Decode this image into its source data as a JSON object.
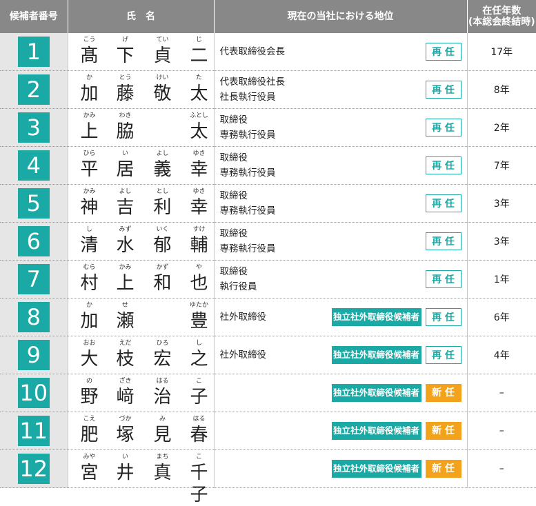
{
  "header": {
    "col_number": "候補者番号",
    "col_name": "氏　名",
    "col_position": "現在の当社における地位",
    "col_years_line1": "在任年数",
    "col_years_line2": "(本総会終結時)"
  },
  "badges": {
    "reappoint": "再 任",
    "new": "新 任",
    "independent": "独立社外取締役候補者"
  },
  "colors": {
    "teal": "#1aa9a5",
    "orange": "#f3a31b",
    "header_gray": "#888888"
  },
  "rows": [
    {
      "number": "1",
      "name": [
        {
          "k": "髙",
          "r": "こう"
        },
        {
          "k": "下",
          "r": "げ"
        },
        {
          "k": "貞",
          "r": "てい"
        },
        {
          "k": "二",
          "r": "じ"
        }
      ],
      "position": [
        "代表取締役会長"
      ],
      "independent": false,
      "status": "reappoint",
      "years": "17年"
    },
    {
      "number": "2",
      "name": [
        {
          "k": "加",
          "r": "か"
        },
        {
          "k": "藤",
          "r": "とう"
        },
        {
          "k": "敬",
          "r": "けい"
        },
        {
          "k": "太",
          "r": "た"
        }
      ],
      "position": [
        "代表取締役社長",
        "社長執行役員"
      ],
      "independent": false,
      "status": "reappoint",
      "years": "8年"
    },
    {
      "number": "3",
      "name": [
        {
          "k": "上",
          "r": "かみ"
        },
        {
          "k": "脇",
          "r": "わき"
        },
        {
          "k": "",
          "r": ""
        },
        {
          "k": "太",
          "r": "ふとし"
        }
      ],
      "position": [
        "取締役",
        "専務執行役員"
      ],
      "independent": false,
      "status": "reappoint",
      "years": "2年"
    },
    {
      "number": "4",
      "name": [
        {
          "k": "平",
          "r": "ひら"
        },
        {
          "k": "居",
          "r": "い"
        },
        {
          "k": "義",
          "r": "よし"
        },
        {
          "k": "幸",
          "r": "ゆき"
        }
      ],
      "position": [
        "取締役",
        "専務執行役員"
      ],
      "independent": false,
      "status": "reappoint",
      "years": "7年"
    },
    {
      "number": "5",
      "name": [
        {
          "k": "神",
          "r": "かみ"
        },
        {
          "k": "吉",
          "r": "よし"
        },
        {
          "k": "利",
          "r": "とし"
        },
        {
          "k": "幸",
          "r": "ゆき"
        }
      ],
      "position": [
        "取締役",
        "専務執行役員"
      ],
      "independent": false,
      "status": "reappoint",
      "years": "3年"
    },
    {
      "number": "6",
      "name": [
        {
          "k": "清",
          "r": "し"
        },
        {
          "k": "水",
          "r": "みず"
        },
        {
          "k": "郁",
          "r": "いく"
        },
        {
          "k": "輔",
          "r": "すけ"
        }
      ],
      "position": [
        "取締役",
        "専務執行役員"
      ],
      "independent": false,
      "status": "reappoint",
      "years": "3年"
    },
    {
      "number": "7",
      "name": [
        {
          "k": "村",
          "r": "むら"
        },
        {
          "k": "上",
          "r": "かみ"
        },
        {
          "k": "和",
          "r": "かず"
        },
        {
          "k": "也",
          "r": "や"
        }
      ],
      "position": [
        "取締役",
        "執行役員"
      ],
      "independent": false,
      "status": "reappoint",
      "years": "1年"
    },
    {
      "number": "8",
      "name": [
        {
          "k": "加",
          "r": "か"
        },
        {
          "k": "瀬",
          "r": "せ"
        },
        {
          "k": "",
          "r": ""
        },
        {
          "k": "豊",
          "r": "ゆたか"
        }
      ],
      "position": [
        "社外取締役"
      ],
      "independent": true,
      "status": "reappoint",
      "years": "6年"
    },
    {
      "number": "9",
      "name": [
        {
          "k": "大",
          "r": "おお"
        },
        {
          "k": "枝",
          "r": "えだ"
        },
        {
          "k": "宏",
          "r": "ひろ"
        },
        {
          "k": "之",
          "r": "し"
        }
      ],
      "position": [
        "社外取締役"
      ],
      "independent": true,
      "status": "reappoint",
      "years": "4年"
    },
    {
      "number": "10",
      "name": [
        {
          "k": "野",
          "r": "の"
        },
        {
          "k": "﨑",
          "r": "ざき"
        },
        {
          "k": "治",
          "r": "はる"
        },
        {
          "k": "子",
          "r": "こ"
        }
      ],
      "position": [],
      "independent": true,
      "status": "new",
      "years": "–"
    },
    {
      "number": "11",
      "name": [
        {
          "k": "肥",
          "r": "こえ"
        },
        {
          "k": "塚",
          "r": "づか"
        },
        {
          "k": "見",
          "r": "み"
        },
        {
          "k": "春",
          "r": "はる"
        }
      ],
      "position": [],
      "independent": true,
      "status": "new",
      "years": "–"
    },
    {
      "number": "12",
      "name": [
        {
          "k": "宮",
          "r": "みや"
        },
        {
          "k": "井",
          "r": "い"
        },
        {
          "k": "真",
          "r": "まち"
        },
        {
          "k": "千子",
          "r": "こ"
        }
      ],
      "position": [],
      "independent": true,
      "status": "new",
      "years": "–"
    }
  ]
}
